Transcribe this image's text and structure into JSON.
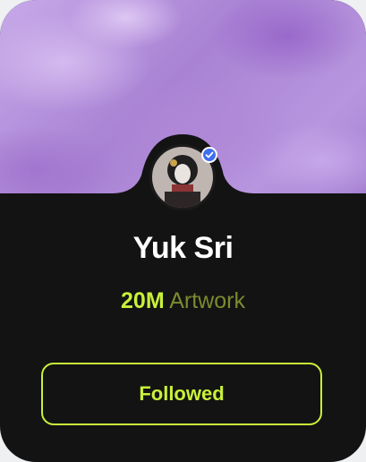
{
  "profile": {
    "name": "Yuk Sri",
    "verified": true,
    "stats": {
      "value": "20M",
      "label": "Artwork"
    },
    "follow_button_label": "Followed"
  },
  "colors": {
    "accent": "#c9f03a",
    "card_background": "#131313",
    "verified_badge": "#3f6ff0"
  },
  "icons": {
    "verified": "check-icon"
  }
}
